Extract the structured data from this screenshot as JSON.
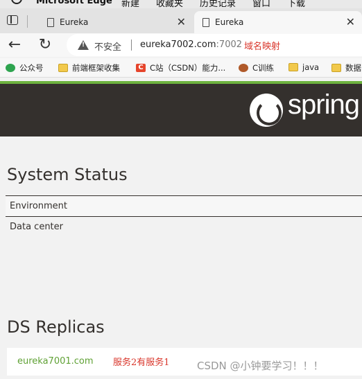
{
  "menubar": {
    "app": "Microsoft Edge",
    "items": [
      "新建",
      "收藏夹",
      "历史记录",
      "窗口",
      "下载"
    ]
  },
  "tabs": [
    {
      "title": "Eureka",
      "close": "✕"
    },
    {
      "title": "Eureka",
      "close": "✕"
    }
  ],
  "nav": {
    "back": "←",
    "reload": "↻"
  },
  "address": {
    "insecure_label": "不安全",
    "url_host": "eureka7002.com",
    "url_port": ":7002",
    "annotation": "域名映射"
  },
  "bookmarks": [
    {
      "label": "公众号",
      "icon": "wechat-icon"
    },
    {
      "label": "前端框架收集",
      "icon": "folder-icon"
    },
    {
      "label": "C站（CSDN）能力...",
      "icon": "csdn-icon"
    },
    {
      "label": "C训练",
      "icon": "person-icon"
    },
    {
      "label": "java",
      "icon": "folder-icon"
    },
    {
      "label": "数据",
      "icon": "folder-icon"
    }
  ],
  "spring": {
    "logo_text": "spring"
  },
  "system_status": {
    "title": "System Status",
    "rows": [
      "Environment",
      "Data center"
    ]
  },
  "ds_replicas": {
    "title": "DS Replicas",
    "link": "eureka7001.com",
    "annotation": "服务2有服务1"
  },
  "watermark": "CSDN @小钟要学习！！！",
  "colors": {
    "spring_dark": "#34302d",
    "spring_green": "#6db33f",
    "annotation_red": "#d9362b"
  }
}
